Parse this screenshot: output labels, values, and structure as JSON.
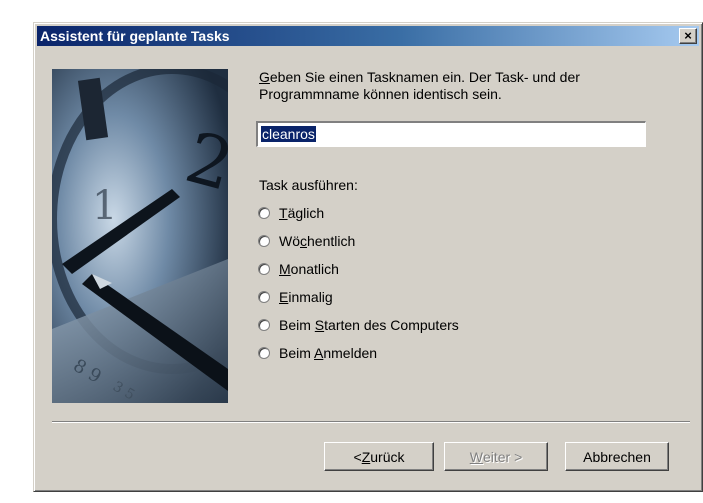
{
  "window": {
    "title": "Assistent für geplante Tasks"
  },
  "titlebar": {
    "close": "×"
  },
  "prompt": {
    "line1_u": "G",
    "line1_rest": "eben Sie einen Tasknamen ein. Der Task- und der",
    "line2": "Programmname können identisch sein."
  },
  "task_name": {
    "value": "cleanros"
  },
  "run_label": "Task ausführen:",
  "options": [
    {
      "pre": "",
      "u": "T",
      "post": "äglich"
    },
    {
      "pre": "Wö",
      "u": "c",
      "post": "hentlich"
    },
    {
      "pre": "",
      "u": "M",
      "post": "onatlich"
    },
    {
      "pre": "",
      "u": "E",
      "post": "inmalig"
    },
    {
      "pre": "Beim ",
      "u": "S",
      "post": "tarten des Computers"
    },
    {
      "pre": "Beim ",
      "u": "A",
      "post": "nmelden"
    }
  ],
  "buttons": {
    "back": {
      "pre": "< ",
      "u": "Z",
      "post": "urück"
    },
    "next": {
      "pre": "",
      "u": "W",
      "post": "eiter >"
    },
    "cancel": "Abbrechen"
  }
}
